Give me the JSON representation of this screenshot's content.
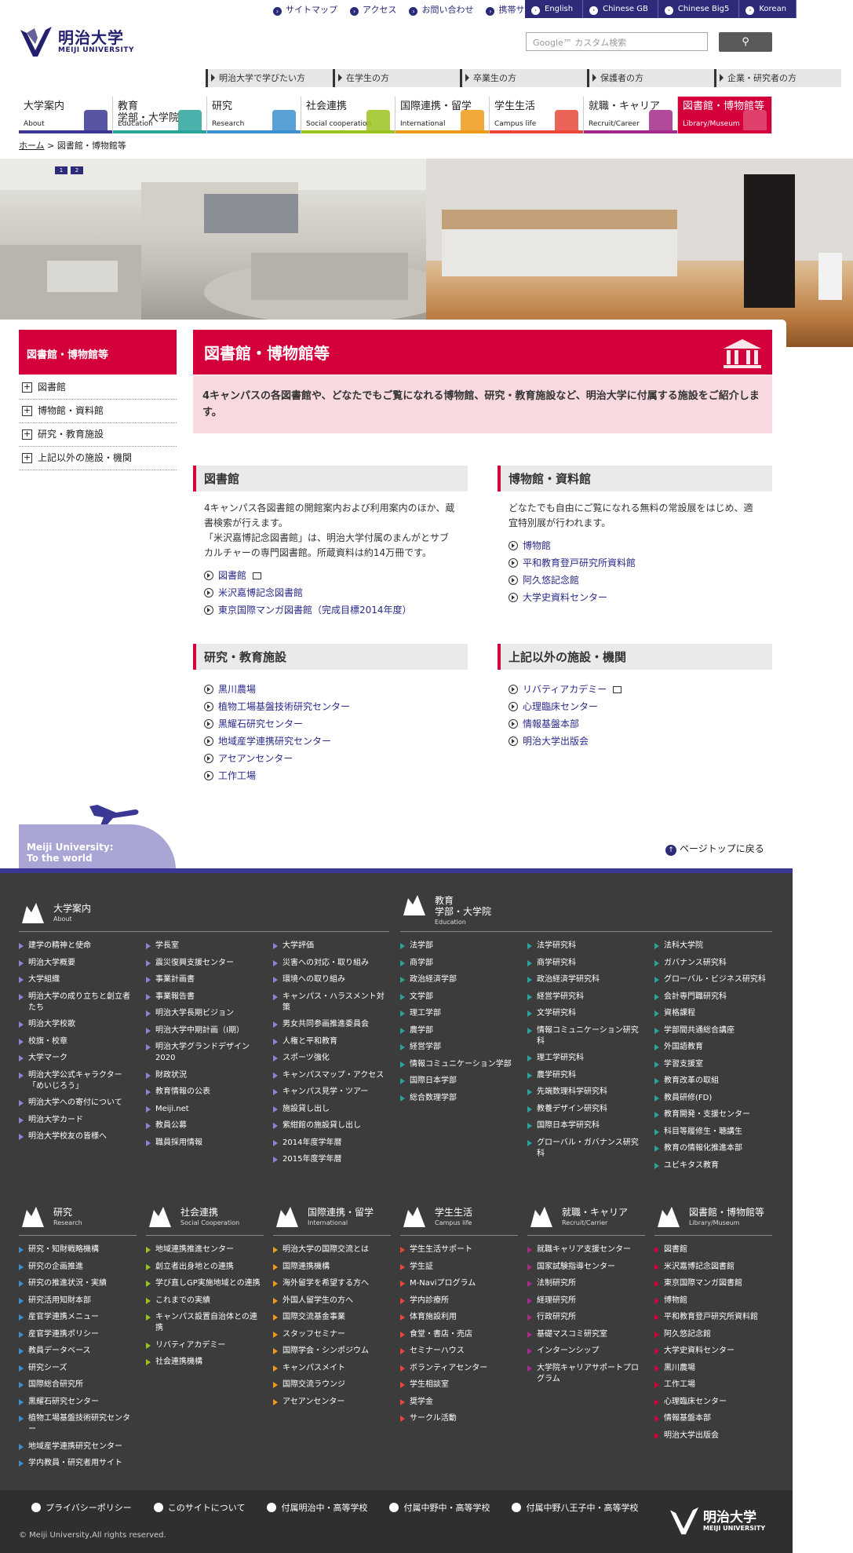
{
  "header": {
    "top_links": [
      "サイトマップ",
      "アクセス",
      "お問い合わせ",
      "携帯サイト"
    ],
    "languages": [
      "English",
      "Chinese GB",
      "Chinese Big5",
      "Korean"
    ],
    "logo_jp": "明治大学",
    "logo_en": "MEIJI UNIVERSITY",
    "search_placeholder": "Google™ カスタム検索",
    "audience": [
      "明治大学で学びたい方",
      "在学生の方",
      "卒業生の方",
      "保護者の方",
      "企業・研究者の方"
    ],
    "gnav": [
      {
        "jp": "大学案内",
        "en": "About",
        "color": "#3b3794"
      },
      {
        "jp": "教育\n学部・大学院",
        "en": "Education",
        "color": "#2aa39c"
      },
      {
        "jp": "研究",
        "en": "Research",
        "color": "#3c8fd0"
      },
      {
        "jp": "社会連携",
        "en": "Social cooperation",
        "color": "#9bc31f"
      },
      {
        "jp": "国際連携・留学",
        "en": "International",
        "color": "#f09a1a"
      },
      {
        "jp": "学生生活",
        "en": "Campus life",
        "color": "#e8473a"
      },
      {
        "jp": "就職・キャリア",
        "en": "Recruit/Career",
        "color": "#a52a8a"
      },
      {
        "jp": "図書館・博物館等",
        "en": "Library/Museum",
        "color": "#d4003b"
      }
    ],
    "breadcrumb_home": "ホーム",
    "breadcrumb_current": "図書館・博物館等"
  },
  "slider": {
    "dots": [
      "1",
      "2"
    ]
  },
  "sidebar": {
    "title": "図書館・博物館等",
    "items": [
      "図書館",
      "博物館・資料館",
      "研究・教育施設",
      "上記以外の施設・機関"
    ]
  },
  "main": {
    "title": "図書館・博物館等",
    "intro": "4キャンパスの各図書館や、どなたでもご覧になれる博物館、研究・教育施設など、明治大学に付属する施設をご紹介します。",
    "sections": [
      {
        "title": "図書館",
        "desc": "4キャンパス各図書館の開館案内および利用案内のほか、蔵書検索が行えます。\n「米沢嘉博記念図書館」は、明治大学付属のまんがとサブカルチャーの専門図書館。所蔵資料は約14万冊です。",
        "links": [
          "図書館",
          "米沢嘉博記念図書館",
          "東京国際マンガ図書館（完成目標2014年度）"
        ]
      },
      {
        "title": "博物館・資料館",
        "desc": "どなたでも自由にご覧になれる無料の常設展をはじめ、適宜特別展が行われます。",
        "links": [
          "博物館",
          "平和教育登戸研究所資料館",
          "阿久悠記念館",
          "大学史資料センター"
        ]
      },
      {
        "title": "研究・教育施設",
        "desc": "",
        "links": [
          "黒川農場",
          "植物工場基盤技術研究センター",
          "黒耀石研究センター",
          "地域産学連携研究センター",
          "アセアンセンター",
          "工作工場"
        ]
      },
      {
        "title": "上記以外の施設・機関",
        "desc": "",
        "links": [
          "リバティアカデミー",
          "心理臨床センター",
          "情報基盤本部",
          "明治大学出版会"
        ]
      }
    ]
  },
  "footer": {
    "world": "Meiji University:\nTo the world",
    "pagetop": "ページトップに戻る",
    "about": {
      "jp": "大学案内",
      "en": "About",
      "col1": [
        "建学の精神と使命",
        "明治大学概要",
        "大学組織",
        "明治大学の成り立ちと創立者たち",
        "明治大学校歌",
        "校旗・校章",
        "大学マーク",
        "明治大学公式キャラクター「めいじろう」",
        "明治大学への寄付について",
        "明治大学カード",
        "明治大学校友の皆様へ"
      ],
      "col2": [
        "学長室",
        "震災復興支援センター",
        "事業計画書",
        "事業報告書",
        "明治大学長期ビジョン",
        "明治大学中期計画（Ⅰ期）",
        "明治大学グランドデザイン2020",
        "財政状況",
        "教育情報の公表",
        "Meiji.net",
        "教員公募",
        "職員採用情報"
      ],
      "col3": [
        "大学評価",
        "災害への対応・取り組み",
        "環境への取り組み",
        "キャンパス・ハラスメント対策",
        "男女共同参画推進委員会",
        "人権と平和教育",
        "スポーツ強化",
        "キャンパスマップ・アクセス",
        "キャンパス見学・ツアー",
        "施設貸し出し",
        "紫紺館の施設貸し出し",
        "2014年度学年暦",
        "2015年度学年暦"
      ]
    },
    "edu": {
      "jp1": "教育",
      "jp2": "学部・大学院",
      "en": "Education",
      "col1": [
        "法学部",
        "商学部",
        "政治経済学部",
        "文学部",
        "理工学部",
        "農学部",
        "経営学部",
        "情報コミュニケーション学部",
        "国際日本学部",
        "総合数理学部"
      ],
      "col2": [
        "法学研究科",
        "商学研究科",
        "政治経済学研究科",
        "経営学研究科",
        "文学研究科",
        "情報コミュニケーション研究科",
        "理工学研究科",
        "農学研究科",
        "先端数理科学研究科",
        "教養デザイン研究科",
        "国際日本学研究科",
        "グローバル・ガバナンス研究科"
      ],
      "col3": [
        "法科大学院",
        "ガバナンス研究科",
        "グローバル・ビジネス研究科",
        "会計専門職研究科",
        "資格課程",
        "学部間共通総合講座",
        "外国語教育",
        "学習支援室",
        "教育改革の取組",
        "教員研修(FD)",
        "教育開発・支援センター",
        "科目等履修生・聴講生",
        "教育の情報化推進本部",
        "ユビキタス教育"
      ]
    },
    "research": {
      "jp": "研究",
      "en": "Research",
      "items": [
        "研究・知財戦略機構",
        "研究の企画推進",
        "研究の推進状況・実績",
        "研究活用知財本部",
        "産官学連携メニュー",
        "産官学連携ポリシー",
        "教員データベース",
        "研究シーズ",
        "国際総合研究所",
        "黒耀石研究センター",
        "植物工場基盤技術研究センター",
        "地域産学連携研究センター",
        "学内教員・研究者用サイト"
      ]
    },
    "social": {
      "jp": "社会連携",
      "en": "Social Cooperation",
      "items": [
        "地域連携推進センター",
        "創立者出身地との連携",
        "学び直しGP実施地域との連携",
        "これまでの実績",
        "キャンパス設置自治体との連携",
        "リバティアカデミー",
        "社会連携機構"
      ]
    },
    "intl": {
      "jp": "国際連携・留学",
      "en": "International",
      "items": [
        "明治大学の国際交流とは",
        "国際連携機構",
        "海外留学を希望する方へ",
        "外国人留学生の方へ",
        "国際交流基金事業",
        "スタッフセミナー",
        "国際学会・シンポジウム",
        "キャンパスメイト",
        "国際交流ラウンジ",
        "アセアンセンター"
      ]
    },
    "campus": {
      "jp": "学生生活",
      "en": "Campus life",
      "items": [
        "学生生活サポート",
        "学生証",
        "M-Naviプログラム",
        "学内診療所",
        "体育施設利用",
        "食堂・書店・売店",
        "セミナーハウス",
        "ボランティアセンター",
        "学生相談室",
        "奨学金",
        "サークル活動"
      ]
    },
    "career": {
      "jp": "就職・キャリア",
      "en": "Recruit/Carrier",
      "items": [
        "就職キャリア支援センター",
        "国家試験指導センター",
        "法制研究所",
        "経理研究所",
        "行政研究所",
        "基礎マスコミ研究室",
        "インターンシップ",
        "大学院キャリアサポートプログラム"
      ]
    },
    "library": {
      "jp": "図書館・博物館等",
      "en": "Library/Museum",
      "items": [
        "図書館",
        "米沢嘉博記念図書館",
        "東京国際マンガ図書館",
        "博物館",
        "平和教育登戸研究所資料館",
        "阿久悠記念館",
        "大学史資料センター",
        "黒川農場",
        "工作工場",
        "心理臨床センター",
        "情報基盤本部",
        "明治大学出版会"
      ]
    },
    "bottom_links": [
      "プライバシーポリシー",
      "このサイトについて",
      "付属明治中・高等学校",
      "付属中野中・高等学校",
      "付属中野八王子中・高等学校"
    ],
    "copyright": "© Meiji University,All rights reserved.",
    "logo_jp": "明治大学",
    "logo_en": "MEIJI UNIVERSITY"
  }
}
